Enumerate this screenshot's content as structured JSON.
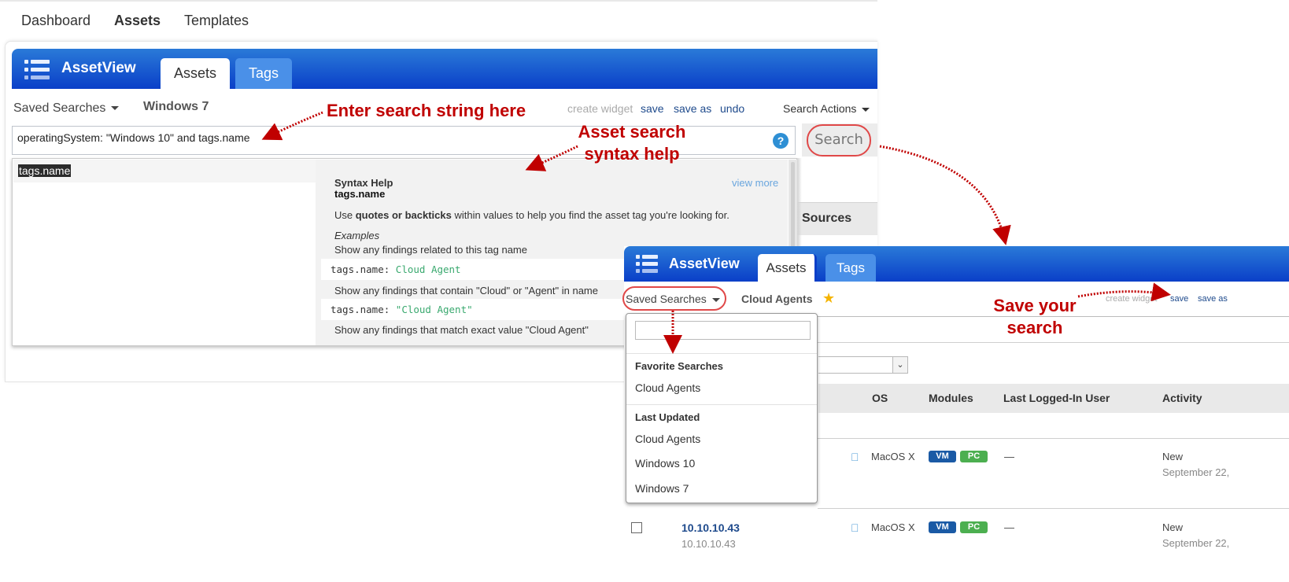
{
  "topnav": {
    "items": [
      {
        "label": "Dashboard",
        "active": false
      },
      {
        "label": "Assets",
        "active": true
      },
      {
        "label": "Templates",
        "active": false
      }
    ]
  },
  "panel_a": {
    "app_title": "AssetView",
    "tabs": [
      {
        "label": "Assets",
        "active": true
      },
      {
        "label": "Tags",
        "active": false
      }
    ],
    "saved_searches_label": "Saved Searches",
    "current_search": "Windows 7",
    "actions": {
      "create_widget": "create widget",
      "save": "save",
      "save_as": "save as",
      "undo": "undo"
    },
    "search_actions_label": "Search Actions",
    "search_query": "operatingSystem: \"Windows 10\" and tags.name",
    "help_icon_glyph": "?",
    "search_button": "Search",
    "suggestion": "tags.name",
    "syntax_help": {
      "title": "Syntax Help",
      "field": "tags.name",
      "view_more": "view more",
      "intro_pre": "Use ",
      "intro_bold": "quotes or backticks",
      "intro_post": " within values to help you find the asset tag you're looking for.",
      "examples_label": "Examples",
      "examples": [
        {
          "desc": "Show any findings related to this tag name",
          "code_key": "tags.name: ",
          "code_val": "Cloud Agent"
        },
        {
          "desc": "Show any findings that contain \"Cloud\" or \"Agent\" in name",
          "code_key": "tags.name: ",
          "code_val": "\"Cloud Agent\""
        },
        {
          "desc": "Show any findings that match exact value \"Cloud Agent\""
        }
      ]
    },
    "sources_header": "Sources"
  },
  "panel_b": {
    "app_title": "AssetView",
    "tabs": [
      {
        "label": "Assets",
        "active": true
      },
      {
        "label": "Tags",
        "active": false
      }
    ],
    "saved_searches_label": "Saved Searches",
    "current_search": "Cloud Agents",
    "favorite": true,
    "actions": {
      "create_widget": "create widget",
      "save": "save",
      "save_as": "save as"
    },
    "saved_searches_menu": {
      "search_value": "",
      "sections": [
        {
          "header": "Favorite Searches",
          "items": [
            "Cloud Agents"
          ]
        },
        {
          "header": "Last Updated",
          "items": [
            "Cloud Agents",
            "Windows 10",
            "Windows 7"
          ]
        }
      ]
    },
    "table": {
      "columns": [
        "OS",
        "Modules",
        "Last Logged-In User",
        "Activity"
      ],
      "rows": [
        {
          "ip": "",
          "ip_sub": "",
          "os": "MacOS X",
          "modules": [
            "VM",
            "PC"
          ],
          "user": "—",
          "activity": "New",
          "activity_date": "September 22,"
        },
        {
          "ip": "10.10.10.43",
          "ip_sub": "10.10.10.43",
          "os": "MacOS X",
          "modules": [
            "VM",
            "PC"
          ],
          "user": "—",
          "activity": "New",
          "activity_date": "September 22,"
        }
      ]
    }
  },
  "annotations": {
    "enter_search": "Enter search string here",
    "syntax_help_1": "Asset search",
    "syntax_help_2": "syntax help",
    "save_search_1": "Save your",
    "save_search_2": "search"
  },
  "colors": {
    "appbar_top": "#2a7ad8",
    "appbar_bottom": "#0a3fc8",
    "annotation": "#c00000",
    "highlight_oval": "#e04848",
    "link": "#1e4a8c",
    "badge_vm": "#1a5aa5",
    "badge_pc": "#4caf50"
  }
}
